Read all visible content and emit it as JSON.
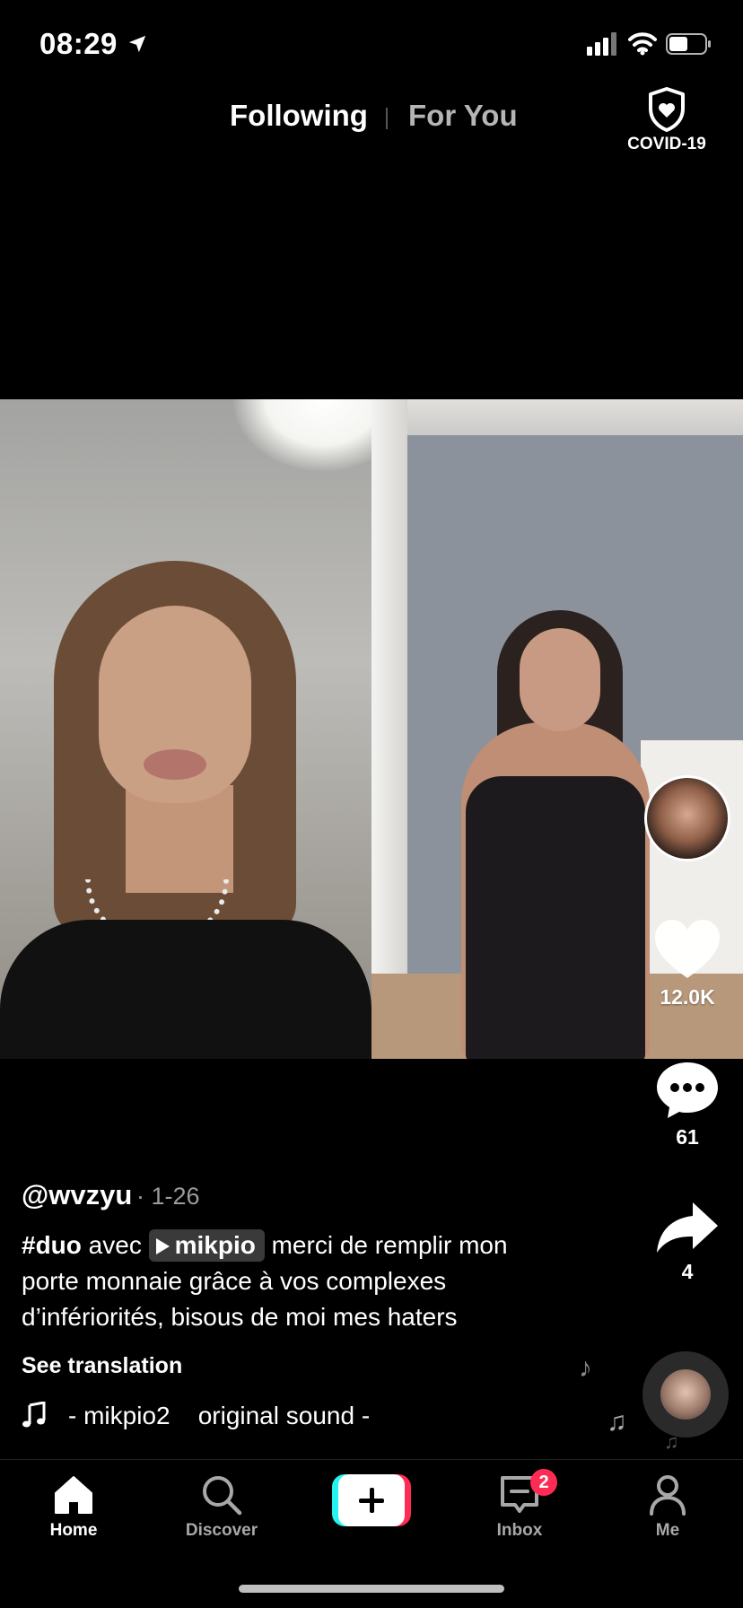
{
  "status_bar": {
    "time": "08:29"
  },
  "tabs": {
    "following": "Following",
    "for_you": "For You",
    "covid": "COVID-19"
  },
  "actions": {
    "likes": "12.0K",
    "comments": "61",
    "shares": "4"
  },
  "post": {
    "author": "@wvzyu",
    "date": "· 1-26",
    "hashtag": "#duo",
    "connector": " avec ",
    "duet_user": "mikpio",
    "caption": " merci de remplir mon porte monnaie grâce à vos complexes d’infériorités, bisous de moi mes haters",
    "see_translation": "See translation",
    "sound": "- mikpio2    original sound -"
  },
  "bottom_nav": {
    "home": "Home",
    "discover": "Discover",
    "inbox": "Inbox",
    "inbox_badge": "2",
    "me": "Me"
  },
  "colors": {
    "background": "#000000",
    "accent_red": "#fe2c55",
    "accent_cyan": "#25f4ee",
    "inactive": "#a8a8a8"
  },
  "icons": {
    "location": "location-arrow-icon",
    "signal": "cellular-signal-icon",
    "wifi": "wifi-icon",
    "battery": "battery-icon",
    "covid": "shield-heart-icon",
    "like": "heart-icon",
    "comment": "comment-bubble-icon",
    "share": "share-arrow-icon",
    "music": "music-note-icon",
    "home": "home-icon",
    "discover": "search-icon",
    "create": "plus-icon",
    "inbox": "inbox-icon",
    "me": "person-icon"
  }
}
